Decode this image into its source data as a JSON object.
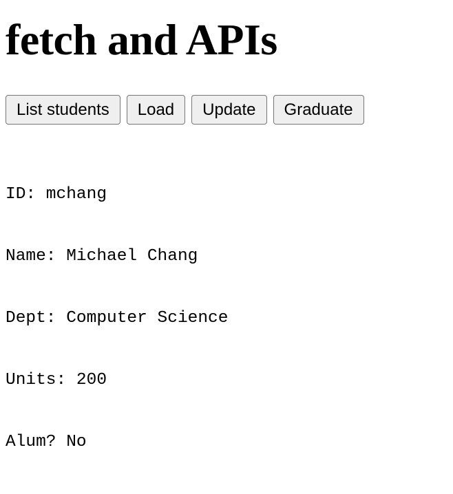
{
  "page": {
    "title": "fetch and APIs"
  },
  "toolbar": {
    "list_students_label": "List students",
    "load_label": "Load",
    "update_label": "Update",
    "graduate_label": "Graduate"
  },
  "student": {
    "lines": [
      "ID: mchang",
      "Name: Michael Chang",
      "Dept: Computer Science",
      "Units: 200",
      "Alum? No"
    ]
  }
}
